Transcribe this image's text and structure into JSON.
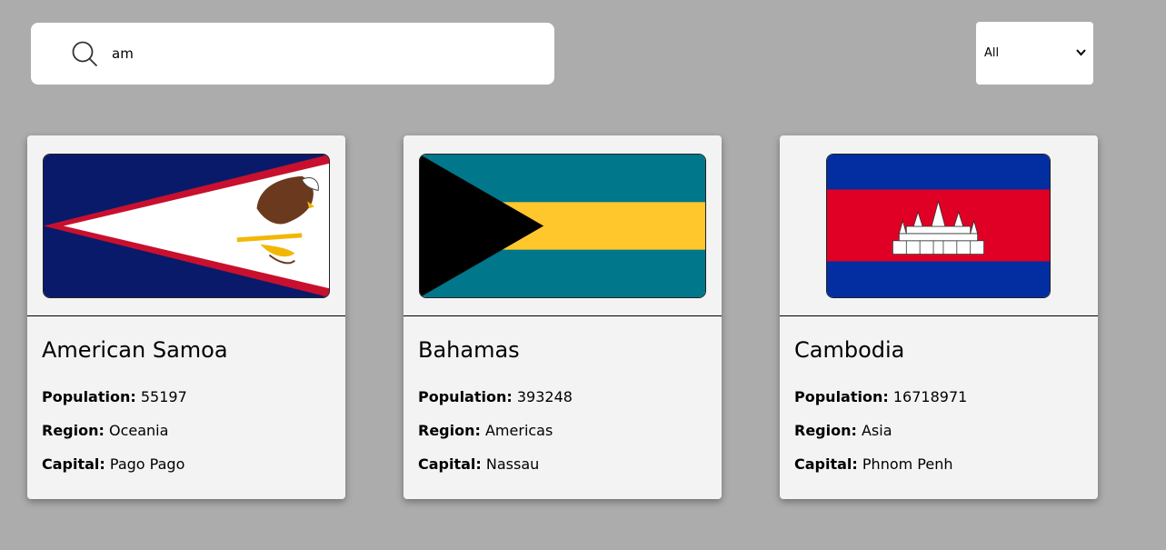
{
  "search": {
    "value": "am",
    "placeholder": ""
  },
  "filter": {
    "selected": "All"
  },
  "labels": {
    "population": "Population:",
    "region": "Region:",
    "capital": "Capital:"
  },
  "countries": [
    {
      "name": "American Samoa",
      "population": "55197",
      "region": "Oceania",
      "capital": "Pago Pago",
      "flag_icon": "american-samoa-flag"
    },
    {
      "name": "Bahamas",
      "population": "393248",
      "region": "Americas",
      "capital": "Nassau",
      "flag_icon": "bahamas-flag"
    },
    {
      "name": "Cambodia",
      "population": "16718971",
      "region": "Asia",
      "capital": "Phnom Penh",
      "flag_icon": "cambodia-flag"
    }
  ],
  "colors": {
    "background": "#acacac",
    "card": "#f3f3f3"
  }
}
